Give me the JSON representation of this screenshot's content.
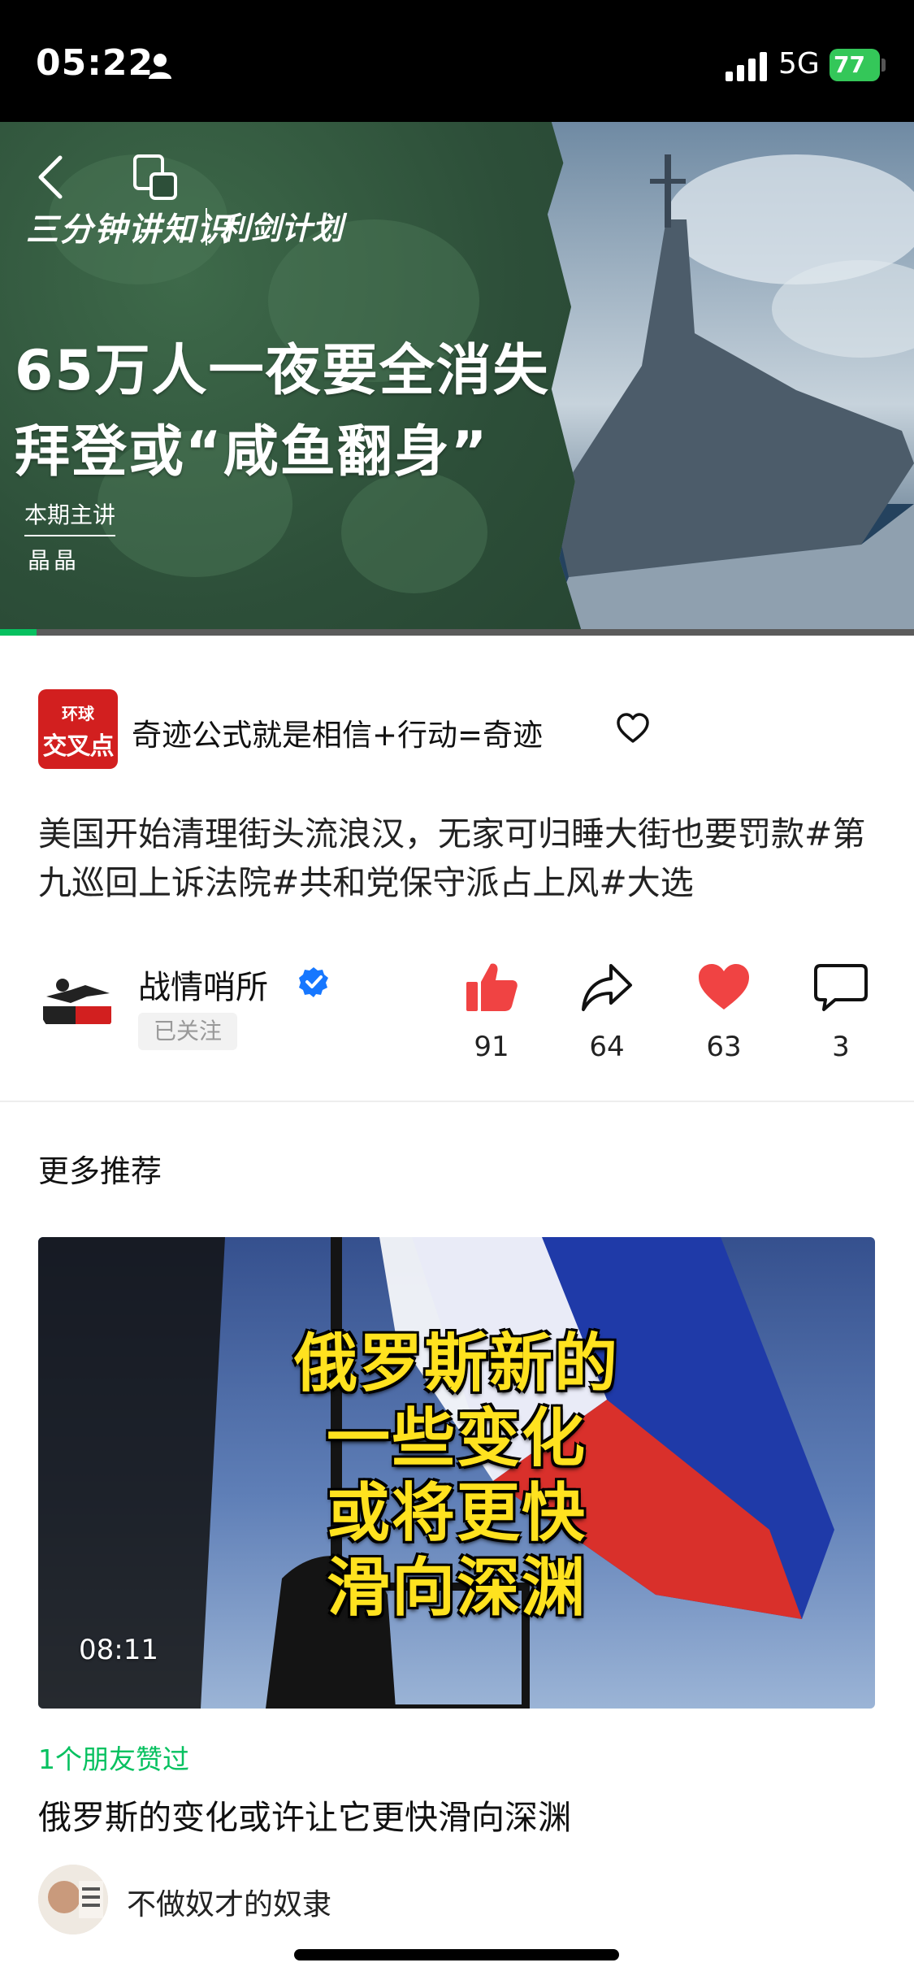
{
  "status_bar": {
    "time": "05:22",
    "network": "5G",
    "battery": "77"
  },
  "video": {
    "logo_text": "三分钟讲知识",
    "logo_sub": "利剑计划",
    "headline_line1": "65万人一夜要全消失",
    "headline_line2": "拜登或“咸鱼翻身”",
    "host_label": "本期主讲",
    "host_name": "晶晶",
    "progress": 0.04
  },
  "channel": {
    "logo_top": "环球",
    "logo_bottom": "交叉点",
    "name": "奇迹公式就是相信+行动=奇迹"
  },
  "description": "美国开始清理街头流浪汉，无家可归睡大街也要罚款#第九巡回上诉法院#共和党保守派占上风#大选",
  "author": {
    "name": "战情哨所",
    "follow_status": "已关注"
  },
  "actions": {
    "like": "91",
    "share": "64",
    "favorite": "63",
    "comment": "3"
  },
  "recommend": {
    "section_title": "更多推荐",
    "thumb_lines": [
      "俄罗斯新的",
      "一些变化",
      "或将更快",
      "滑向深渊"
    ],
    "duration": "08:11",
    "friends_liked": "1个朋友赞过",
    "title": "俄罗斯的变化或许让它更快滑向深渊",
    "author": "不做奴才的奴隶"
  },
  "colors": {
    "accent_green": "#07c160",
    "like_red": "#f04343",
    "verified_blue": "#1677ff"
  }
}
